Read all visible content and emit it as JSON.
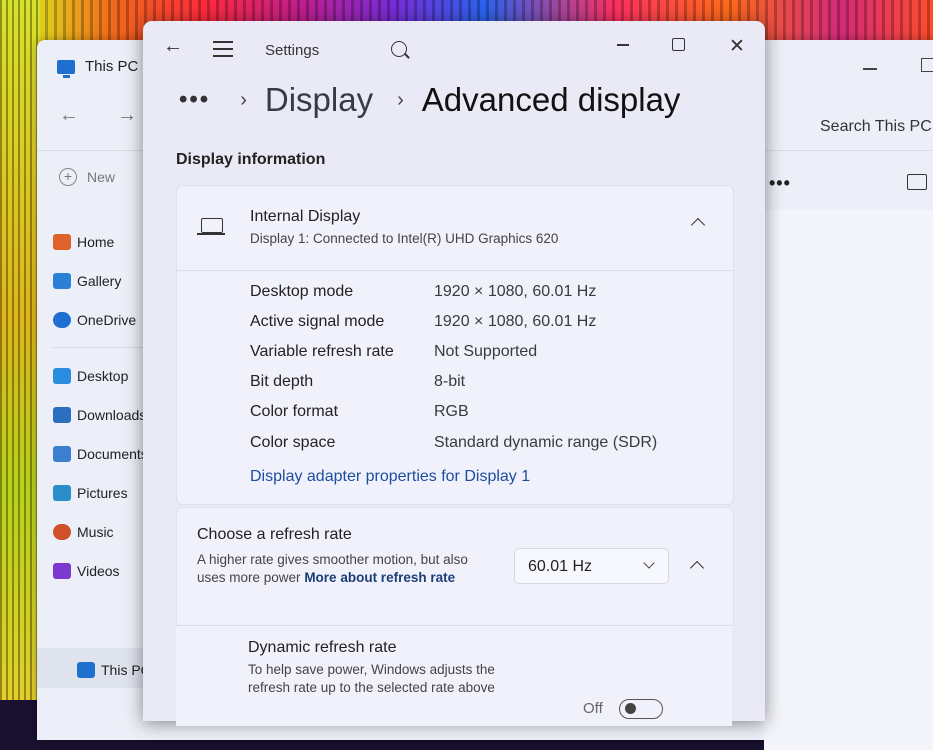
{
  "explorer": {
    "title": "This PC",
    "new_label": "New",
    "search_placeholder": "Search This PC",
    "sidebar": [
      {
        "label": "Home",
        "icon": "home-icon",
        "color": "#e0612a"
      },
      {
        "label": "Gallery",
        "icon": "gallery-icon",
        "color": "#2a7fd6"
      },
      {
        "label": "OneDrive",
        "icon": "cloud-icon",
        "color": "#1f6fd1"
      },
      {
        "label": "Desktop",
        "icon": "desktop-icon",
        "color": "#2a8ee0"
      },
      {
        "label": "Downloads",
        "icon": "download-icon",
        "color": "#2a6fc0"
      },
      {
        "label": "Documents",
        "icon": "documents-icon",
        "color": "#3a7fd0"
      },
      {
        "label": "Pictures",
        "icon": "pictures-icon",
        "color": "#2a8ec8"
      },
      {
        "label": "Music",
        "icon": "music-icon",
        "color": "#d0502a"
      },
      {
        "label": "Videos",
        "icon": "videos-icon",
        "color": "#7a3ad0"
      },
      {
        "label": "This PC",
        "icon": "computer-icon",
        "color": "#1f6fd1"
      }
    ]
  },
  "settings": {
    "window_title": "Settings",
    "breadcrumb": {
      "more": "•••",
      "parent": "Display",
      "current": "Advanced display"
    },
    "section_title": "Display information",
    "display_card": {
      "name": "Internal Display",
      "subtitle": "Display 1: Connected to Intel(R) UHD Graphics 620",
      "rows": [
        {
          "key": "Desktop mode",
          "value": "1920 × 1080, 60.01 Hz"
        },
        {
          "key": "Active signal mode",
          "value": "1920 × 1080, 60.01 Hz"
        },
        {
          "key": "Variable refresh rate",
          "value": "Not Supported"
        },
        {
          "key": "Bit depth",
          "value": "8-bit"
        },
        {
          "key": "Color format",
          "value": "RGB"
        },
        {
          "key": "Color space",
          "value": "Standard dynamic range (SDR)"
        }
      ],
      "link": "Display adapter properties for Display 1"
    },
    "refresh_card": {
      "title": "Choose a refresh rate",
      "desc": "A higher rate gives smoother motion, but also uses more power",
      "desc_link": "More about refresh rate",
      "selected": "60.01 Hz"
    },
    "dynamic_card": {
      "title": "Dynamic refresh rate",
      "desc": "To help save power, Windows adjusts the refresh rate up to the selected rate above",
      "toggle_state": "Off",
      "toggle_on": false
    }
  }
}
